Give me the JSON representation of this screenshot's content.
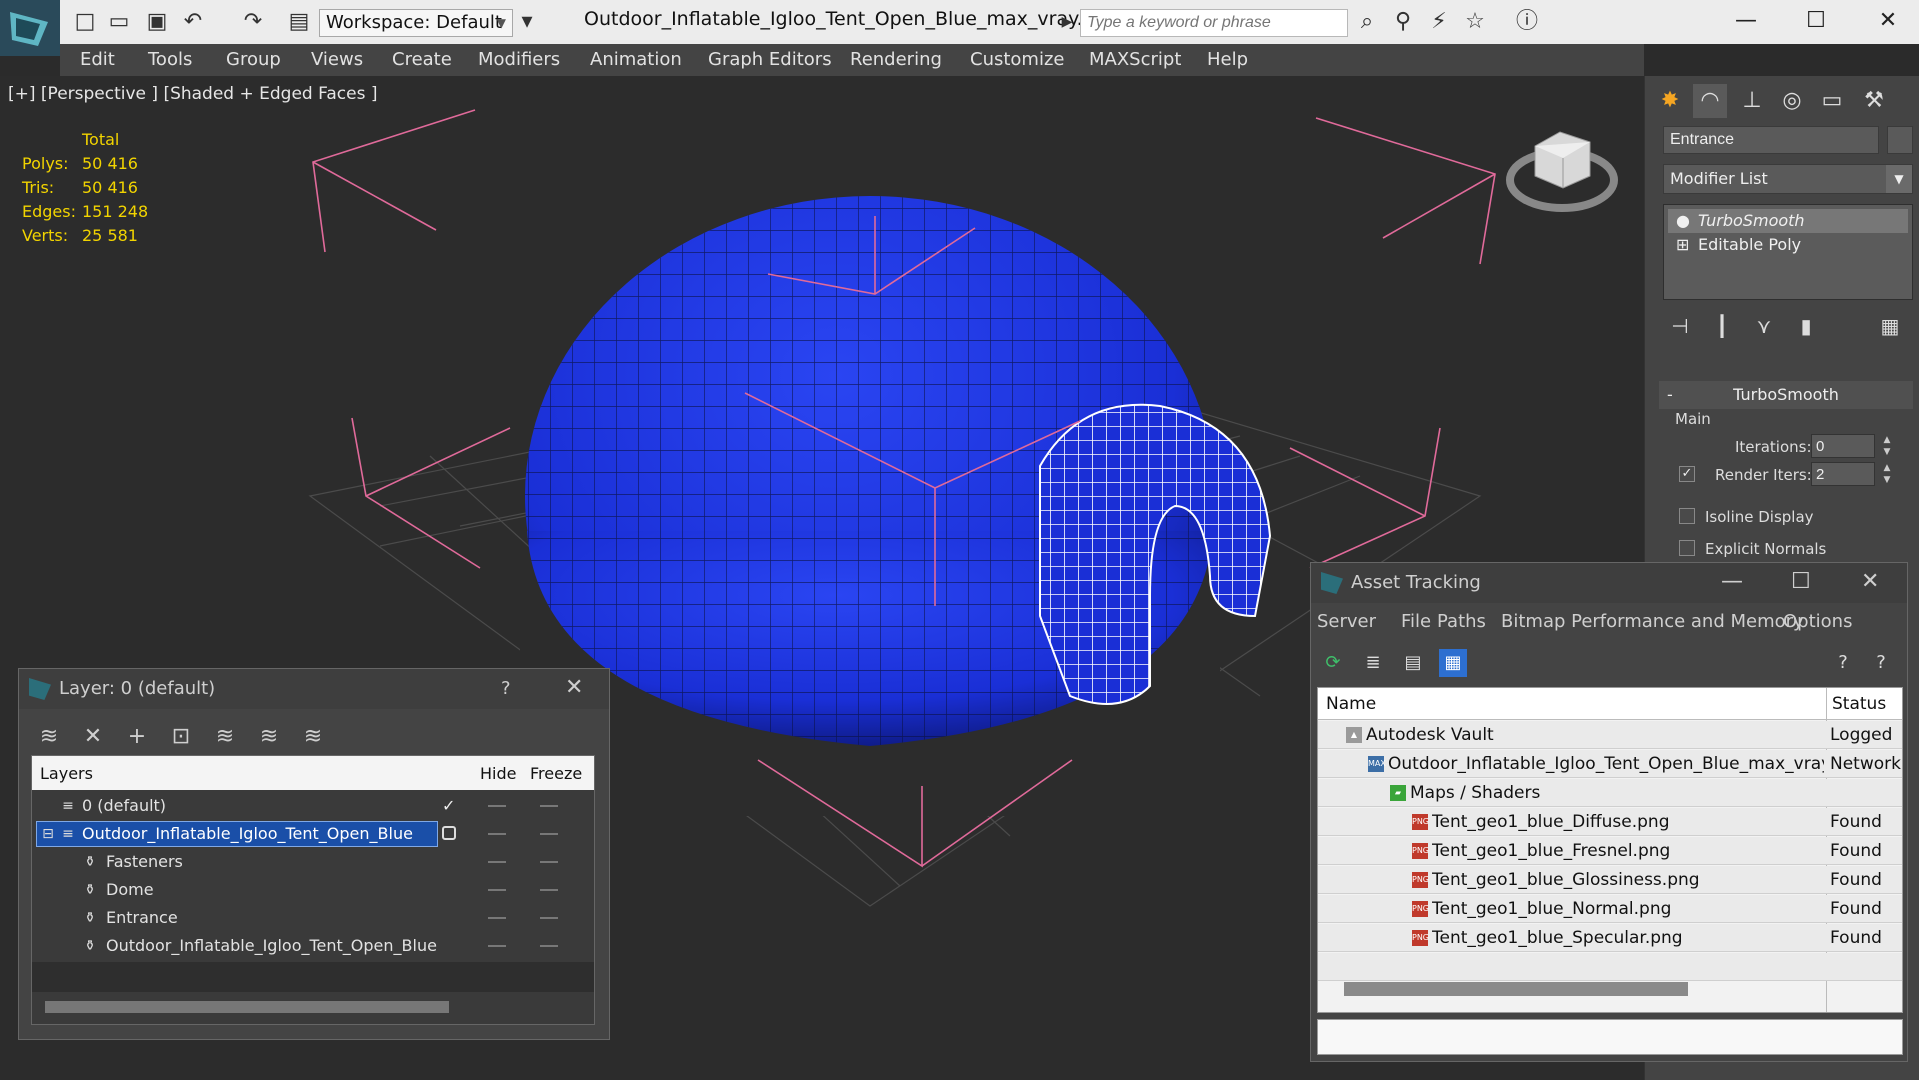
{
  "titlebar": {
    "workspace_label": "Workspace: Default",
    "file_title": "Outdoor_Inflatable_Igloo_Tent_Open_Blue_max_vray.max",
    "search_placeholder": "Type a keyword or phrase"
  },
  "menu": [
    "Edit",
    "Tools",
    "Group",
    "Views",
    "Create",
    "Modifiers",
    "Animation",
    "Graph Editors",
    "Rendering",
    "Customize",
    "MAXScript",
    "Help"
  ],
  "viewport": {
    "label": "[+] [Perspective ] [Shaded + Edged Faces ]",
    "stats": {
      "header": "Total",
      "rows": [
        {
          "k": "Polys:",
          "v": "50 416"
        },
        {
          "k": "Tris:",
          "v": "50 416"
        },
        {
          "k": "Edges:",
          "v": "151 248"
        },
        {
          "k": "Verts:",
          "v": "25 581"
        }
      ]
    },
    "colors": {
      "dome": "#1a2fd6",
      "bracket": "#e06a9a",
      "grid": "#4a4a4a"
    }
  },
  "command_panel": {
    "object_name": "Entrance",
    "modifier_list": "Modifier List",
    "stack": [
      "TurboSmooth",
      "Editable Poly"
    ],
    "rollout_title": "TurboSmooth",
    "group_main": "Main",
    "iterations_label": "Iterations:",
    "iterations_value": "0",
    "render_iters_label": "Render Iters:",
    "render_iters_value": "2",
    "isoline_label": "Isoline Display",
    "explicit_normals_label": "Explicit Normals"
  },
  "layer_dialog": {
    "title": "Layer: 0 (default)",
    "help": "?",
    "columns": {
      "layers": "Layers",
      "hide": "Hide",
      "freeze": "Freeze"
    },
    "rows": [
      {
        "name": "0 (default)",
        "indent": 0
      },
      {
        "name": "Outdoor_Inflatable_Igloo_Tent_Open_Blue",
        "indent": 0
      },
      {
        "name": "Fasteners",
        "indent": 1
      },
      {
        "name": "Dome",
        "indent": 1
      },
      {
        "name": "Entrance",
        "indent": 1
      },
      {
        "name": "Outdoor_Inflatable_Igloo_Tent_Open_Blue",
        "indent": 1
      }
    ]
  },
  "asset_dialog": {
    "title": "Asset Tracking",
    "menu": [
      "Server",
      "File",
      "Paths",
      "Bitmap Performance and Memory",
      "Options"
    ],
    "columns": {
      "name": "Name",
      "status": "Status"
    },
    "rows": [
      {
        "name": "Autodesk Vault",
        "status": "Logged",
        "indent": 1,
        "icon": "vault-icon"
      },
      {
        "name": "Outdoor_Inflatable_Igloo_Tent_Open_Blue_max_vray...",
        "status": "Network",
        "indent": 2,
        "icon": "max-file-icon"
      },
      {
        "name": "Maps / Shaders",
        "status": "",
        "indent": 3,
        "icon": "maps-folder-icon"
      },
      {
        "name": "Tent_geo1_blue_Diffuse.png",
        "status": "Found",
        "indent": 4,
        "icon": "png-icon"
      },
      {
        "name": "Tent_geo1_blue_Fresnel.png",
        "status": "Found",
        "indent": 4,
        "icon": "png-icon"
      },
      {
        "name": "Tent_geo1_blue_Glossiness.png",
        "status": "Found",
        "indent": 4,
        "icon": "png-icon"
      },
      {
        "name": "Tent_geo1_blue_Normal.png",
        "status": "Found",
        "indent": 4,
        "icon": "png-icon"
      },
      {
        "name": "Tent_geo1_blue_Specular.png",
        "status": "Found",
        "indent": 4,
        "icon": "png-icon"
      }
    ]
  }
}
